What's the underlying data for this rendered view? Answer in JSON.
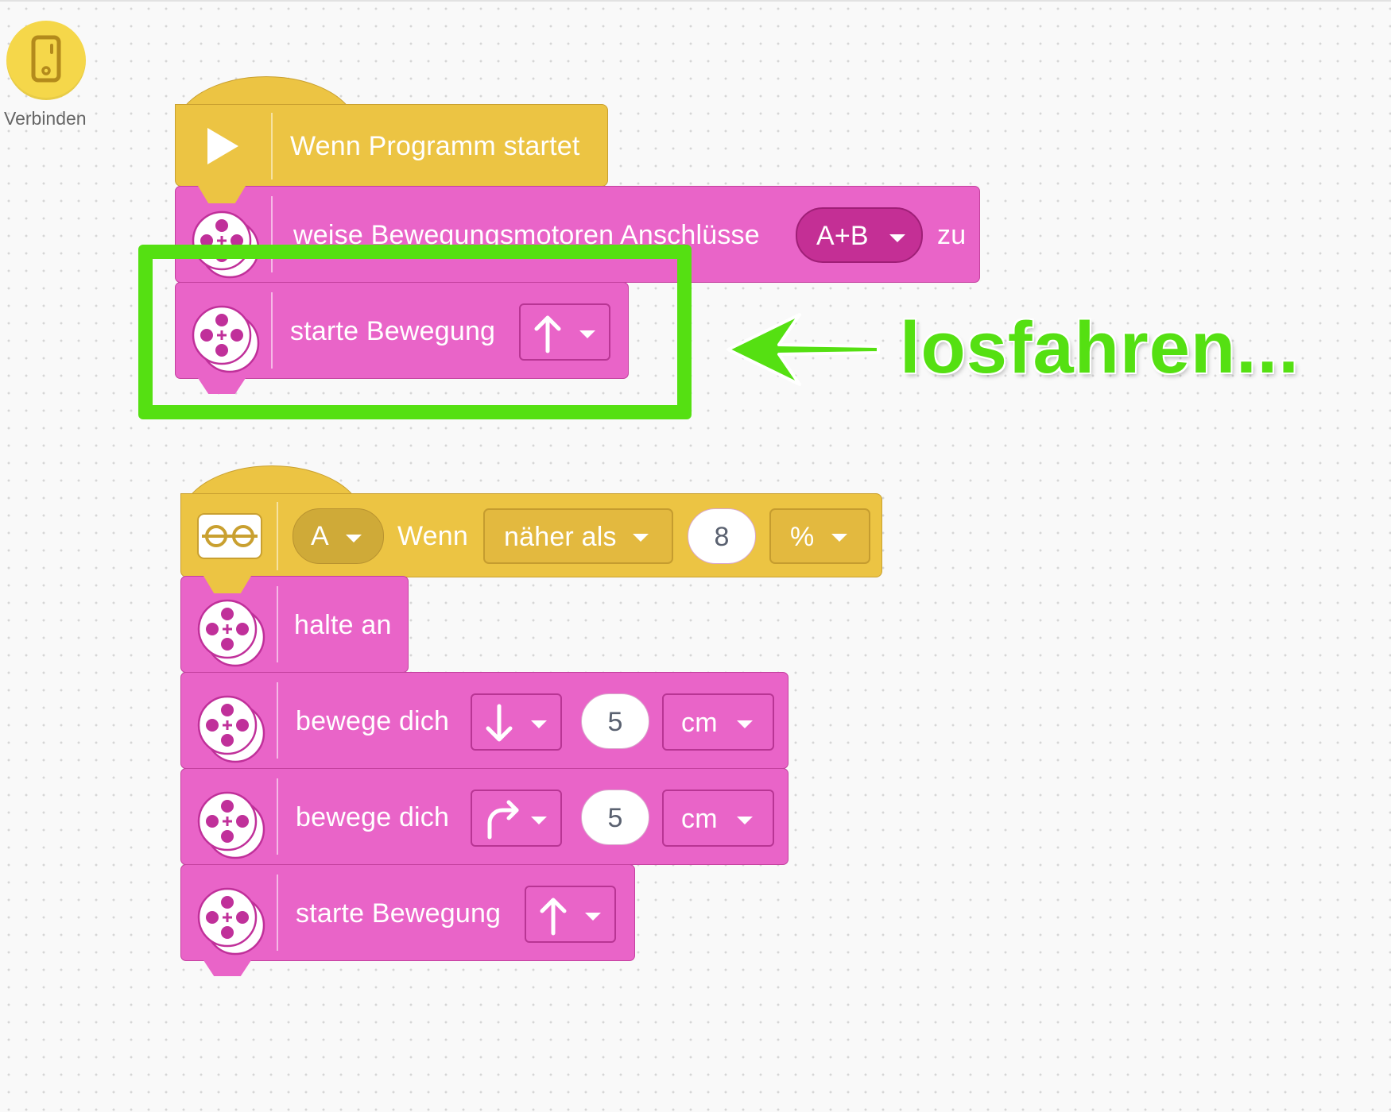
{
  "connect": {
    "label": "Verbinden",
    "icon": "hub-icon"
  },
  "stack1": {
    "hat": {
      "label": "Wenn Programm startet",
      "icon": "play-icon"
    },
    "assign": {
      "label": "weise Bewegungsmotoren Anschlüsse",
      "ports": "A+B",
      "suffix": "zu",
      "icon": "motor-icon"
    },
    "start": {
      "label": "starte Bewegung",
      "direction_icon": "arrow-up-icon"
    }
  },
  "annotation": {
    "text": "losfahren...",
    "color": "#55e012"
  },
  "stack2": {
    "hat": {
      "port": "A",
      "when": "Wenn",
      "condition": "näher als",
      "value": "8",
      "unit": "%",
      "icon": "distance-sensor-icon"
    },
    "stop": {
      "label": "halte an"
    },
    "move1": {
      "label": "bewege dich",
      "direction_icon": "arrow-down-icon",
      "value": "5",
      "unit": "cm"
    },
    "move2": {
      "label": "bewege dich",
      "direction_icon": "turn-right-icon",
      "value": "5",
      "unit": "cm"
    },
    "start": {
      "label": "starte Bewegung",
      "direction_icon": "arrow-up-icon"
    }
  },
  "colors": {
    "motion": "#e964c8",
    "event": "#ecc443",
    "highlight": "#55e012"
  }
}
